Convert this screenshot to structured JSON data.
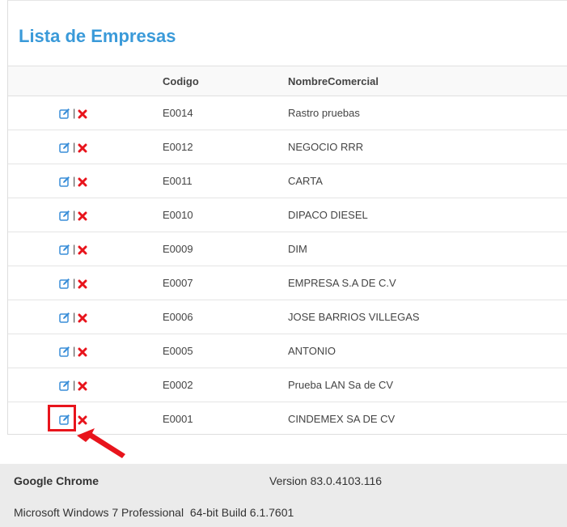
{
  "page": {
    "title": "Lista de Empresas"
  },
  "table": {
    "headers": [
      "",
      "Codigo",
      "NombreComercial"
    ],
    "separator": "|",
    "rows": [
      {
        "codigo": "E0014",
        "nombre": "Rastro pruebas"
      },
      {
        "codigo": "E0012",
        "nombre": "NEGOCIO RRR"
      },
      {
        "codigo": "E0011",
        "nombre": "CARTA"
      },
      {
        "codigo": "E0010",
        "nombre": "DIPACO DIESEL"
      },
      {
        "codigo": "E0009",
        "nombre": "DIM"
      },
      {
        "codigo": "E0007",
        "nombre": "EMPRESA S.A DE C.V"
      },
      {
        "codigo": "E0006",
        "nombre": "JOSE BARRIOS VILLEGAS"
      },
      {
        "codigo": "E0005",
        "nombre": "ANTONIO"
      },
      {
        "codigo": "E0002",
        "nombre": "Prueba LAN Sa de CV"
      },
      {
        "codigo": "E0001",
        "nombre": "CINDEMEX SA DE CV"
      }
    ]
  },
  "footer": {
    "browser": "Google Chrome",
    "version": "Version 83.0.4103.116",
    "os": "Microsoft Windows 7 Professional  64-bit Build 6.1.7601"
  },
  "icons": {
    "edit": "edit-icon",
    "delete": "delete-x-icon",
    "pointer": "red-arrow-icon"
  },
  "colors": {
    "title": "#3a9ad9",
    "edit_icon": "#3a8ed8",
    "delete_icon": "#e8141c",
    "annotation": "#e8141c"
  }
}
